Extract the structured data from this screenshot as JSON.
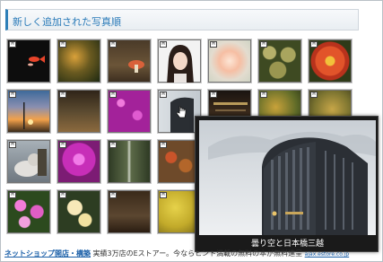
{
  "header": {
    "title": "新しく追加された写真順"
  },
  "thumb_badge": "M",
  "thumbnails": [
    {
      "name": "thumb-goldfish"
    },
    {
      "name": "thumb-autumn-tree"
    },
    {
      "name": "thumb-mushroom"
    },
    {
      "name": "thumb-portrait-girl"
    },
    {
      "name": "thumb-rose"
    },
    {
      "name": "thumb-cactus"
    },
    {
      "name": "thumb-red-chrysanthemum"
    },
    {
      "name": "thumb-sunset"
    },
    {
      "name": "thumb-forest-path"
    },
    {
      "name": "thumb-purple-flowers"
    },
    {
      "name": "thumb-building"
    },
    {
      "name": "thumb-shrine"
    },
    {
      "name": "thumb-yellow-foliage"
    },
    {
      "name": "thumb-ginkgo"
    },
    {
      "name": "thumb-cat"
    },
    {
      "name": "thumb-purple-mums"
    },
    {
      "name": "thumb-alley"
    },
    {
      "name": "thumb-maple-leaves"
    },
    {
      "name": "thumb-chrysanthemums"
    },
    {
      "name": "thumb-white-mums"
    },
    {
      "name": "thumb-stone-lantern"
    },
    {
      "name": "thumb-yellow-leaves"
    }
  ],
  "popup": {
    "caption": "曇り空と日本橋三越"
  },
  "footer": {
    "link": "ネットショップ開店・構築",
    "text": " 実績3万店のEストアー。今ならヒント満載の無料の本が無料進呈",
    "url": "ajax.estore.co.jp"
  }
}
